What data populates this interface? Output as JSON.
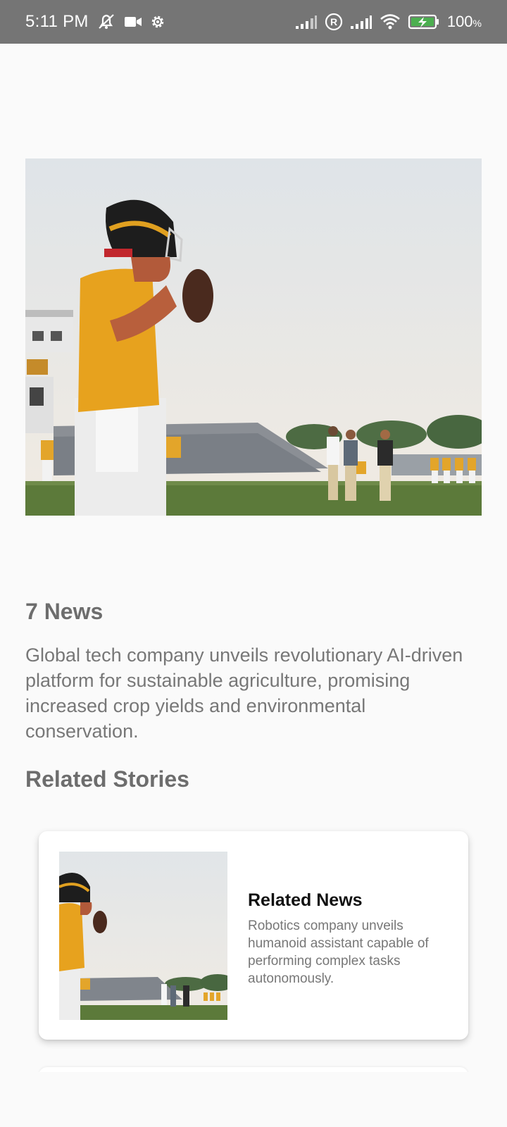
{
  "status_bar": {
    "time": "5:11 PM",
    "battery_value": "100",
    "battery_unit": "%",
    "icons": [
      "mute-icon",
      "video-camera-icon",
      "settings-icon",
      "signal-icon",
      "registered-icon",
      "signal-icon",
      "wifi-icon",
      "battery-charging-icon"
    ]
  },
  "article": {
    "source": "7 News",
    "headline": "Global tech company unveils revolutionary AI-driven platform for sustainable agriculture, promising increased crop yields and environmental conservation.",
    "hero_image_alt": "football-player-photo"
  },
  "related": {
    "section_title": "Related Stories",
    "items": [
      {
        "title": "Related News",
        "description": "Robotics company unveils humanoid assistant capable of performing complex tasks autonomously."
      }
    ]
  },
  "colors": {
    "status_bar_bg": "#757575",
    "page_bg": "#fafafa",
    "muted_text": "#777777",
    "card_bg": "#ffffff"
  }
}
